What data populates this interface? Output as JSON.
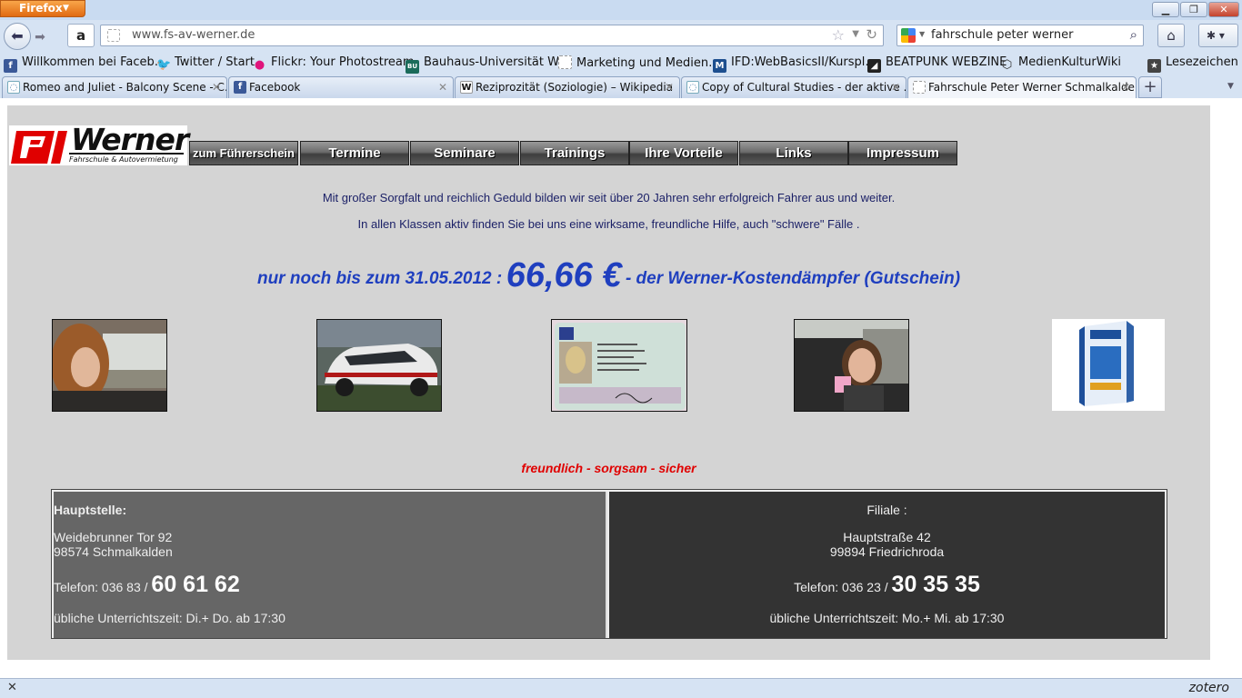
{
  "browser": {
    "menu_label": "Firefox",
    "url": "www.fs-av-werner.de",
    "search_query": "fahrschule peter werner",
    "bookmarks": [
      {
        "label": "Willkommen bei Faceb…",
        "icon": "facebook-icon"
      },
      {
        "label": "Twitter / Start",
        "icon": "twitter-icon"
      },
      {
        "label": "Flickr: Your Photostream",
        "icon": "flickr-icon"
      },
      {
        "label": "Bauhaus-Universität W…",
        "icon": "bauhaus-icon"
      },
      {
        "label": "Marketing und Medien…",
        "icon": "page-icon"
      },
      {
        "label": "IFD:WebBasicsII/Kurspl…",
        "icon": "m-icon"
      },
      {
        "label": "BEATPUNK WEBZINE",
        "icon": "beatpunk-icon"
      },
      {
        "label": "MedienKulturWiki",
        "icon": "cube-icon"
      },
      {
        "label": "Lesezeichen",
        "icon": "bookmarks-icon"
      }
    ],
    "tabs": [
      {
        "label": "Romeo and Juliet - Balcony Scene - C…",
        "icon": "globe-icon"
      },
      {
        "label": "Facebook",
        "icon": "facebook-icon"
      },
      {
        "label": "Reziprozität (Soziologie) – Wikipedia",
        "icon": "wikipedia-icon"
      },
      {
        "label": "Copy of Cultural Studies - der aktive …",
        "icon": "globe-icon"
      },
      {
        "label": "Fahrschule Peter Werner Schmalkalden",
        "icon": "page-icon",
        "active": true
      }
    ],
    "status_right": "zotero"
  },
  "site": {
    "logo": {
      "name": "Werner",
      "subtitle": "Fahrschule & Autovermietung"
    },
    "nav": [
      "zum Führerschein",
      "Termine",
      "Seminare",
      "Trainings",
      "Ihre Vorteile",
      "Links",
      "Impressum"
    ],
    "intro_1": "Mit großer Sorgfalt und reichlich Geduld bilden wir seit über 20 Jahren sehr erfolgreich Fahrer aus und weiter.",
    "intro_2": "In allen Klassen aktiv finden Sie bei uns eine wirksame, freundliche Hilfe, auch \"schwere\" Fälle .",
    "promo": {
      "prefix": "nur noch bis zum 31.05.2012 :",
      "amount": "66,66 €",
      "suffix": "- der Werner-Kostendämpfer (Gutschein)"
    },
    "slogan": "freundlich - sorgsam - sicher",
    "offices": {
      "main": {
        "heading": "Hauptstelle:",
        "street": "Weidebrunner Tor 92",
        "city": "98574 Schmalkalden",
        "phone_prefix": "Telefon: 036 83 /",
        "phone_number": "60 61 62",
        "hours": "übliche Unterrichtszeit: Di.+ Do. ab 17:30"
      },
      "branch": {
        "heading": "Filiale :",
        "street": "Hauptstraße 42",
        "city": "99894 Friedrichroda",
        "phone_prefix": "Telefon: 036 23 /",
        "phone_number": "30 35 35",
        "hours": "übliche Unterrichtszeit: Mo.+ Mi. ab 17:30"
      }
    }
  }
}
